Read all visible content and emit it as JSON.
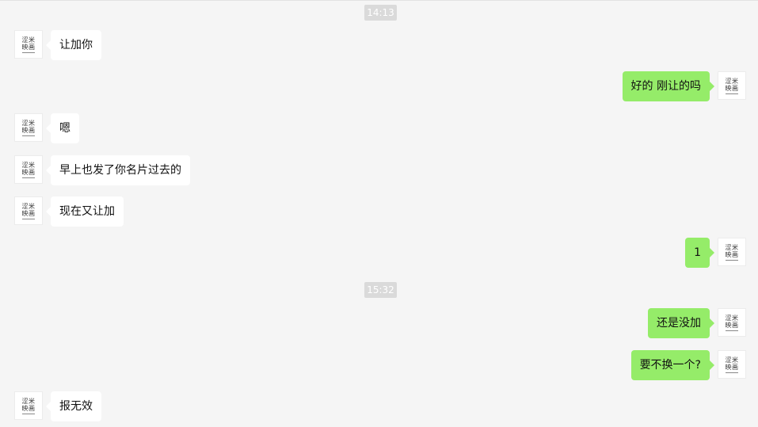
{
  "avatar": {
    "line1": "涩米",
    "line2": "映画"
  },
  "colors": {
    "background": "#f5f5f5",
    "incoming_bubble": "#ffffff",
    "outgoing_bubble": "#95ec69",
    "timestamp_bg": "#dadada"
  },
  "timestamps": [
    "14:13",
    "15:32"
  ],
  "messages": [
    {
      "dir": "in",
      "text": "让加你"
    },
    {
      "dir": "out",
      "text": "好的 刚让的吗"
    },
    {
      "dir": "in",
      "text": "嗯"
    },
    {
      "dir": "in",
      "text": "早上也发了你名片过去的"
    },
    {
      "dir": "in",
      "text": "现在又让加"
    },
    {
      "dir": "out",
      "text": "1"
    },
    {
      "dir": "out",
      "text": "还是没加"
    },
    {
      "dir": "out",
      "text": "要不换一个?"
    },
    {
      "dir": "in",
      "text": "报无效"
    }
  ]
}
